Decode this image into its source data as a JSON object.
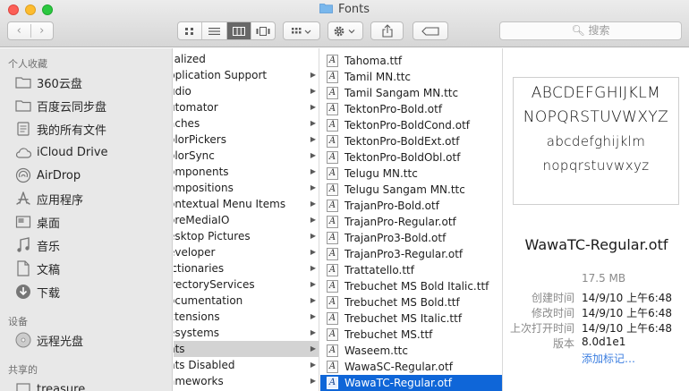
{
  "window": {
    "title": "Fonts"
  },
  "toolbar": {
    "search_placeholder": "搜索"
  },
  "sidebar": {
    "favorites_header": "个人收藏",
    "favorites": [
      {
        "label": "360云盘",
        "icon": "folder-icon"
      },
      {
        "label": "百度云同步盘",
        "icon": "folder-icon"
      },
      {
        "label": "我的所有文件",
        "icon": "all-files-icon"
      },
      {
        "label": "iCloud Drive",
        "icon": "cloud-icon"
      },
      {
        "label": "AirDrop",
        "icon": "airdrop-icon"
      },
      {
        "label": "应用程序",
        "icon": "applications-icon"
      },
      {
        "label": "桌面",
        "icon": "desktop-icon"
      },
      {
        "label": "音乐",
        "icon": "music-icon"
      },
      {
        "label": "文稿",
        "icon": "documents-icon"
      },
      {
        "label": "下载",
        "icon": "downloads-icon"
      }
    ],
    "devices_header": "设备",
    "devices": [
      {
        "label": "远程光盘",
        "icon": "disc-icon"
      }
    ],
    "shared_header": "共享的",
    "shared": [
      {
        "label": "treasure",
        "icon": "network-computer-icon"
      }
    ]
  },
  "library_column": {
    "items": [
      "calized",
      "pplication Support",
      "udio",
      "utomator",
      "aches",
      "olorPickers",
      "olorSync",
      "omponents",
      "ompositions",
      "ontextual Menu Items",
      "oreMediaIO",
      "esktop Pictures",
      "eveloper",
      "ictionaries",
      "irectoryServices",
      "ocumentation",
      "xtensions",
      "esystems",
      "nts",
      "nts Disabled",
      "ameworks"
    ],
    "selected_index": 18
  },
  "fonts_column": {
    "items": [
      "Tahoma.ttf",
      "Tamil MN.ttc",
      "Tamil Sangam MN.ttc",
      "TektonPro-Bold.otf",
      "TektonPro-BoldCond.otf",
      "TektonPro-BoldExt.otf",
      "TektonPro-BoldObl.otf",
      "Telugu MN.ttc",
      "Telugu Sangam MN.ttc",
      "TrajanPro-Bold.otf",
      "TrajanPro-Regular.otf",
      "TrajanPro3-Bold.otf",
      "TrajanPro3-Regular.otf",
      "Trattatello.ttf",
      "Trebuchet MS Bold Italic.ttf",
      "Trebuchet MS Bold.ttf",
      "Trebuchet MS Italic.ttf",
      "Trebuchet MS.ttf",
      "Waseem.ttc",
      "WawaSC-Regular.otf",
      "WawaTC-Regular.otf"
    ],
    "selected_index": 20
  },
  "preview": {
    "sample_lines": [
      "ABCDEFGHIJKLM",
      "NOPQRSTUVWXYZ",
      "abcdefghijklm",
      "nopqrstuvwxyz"
    ],
    "file_name": "WawaTC-Regular.otf",
    "size": "17.5 MB",
    "created_label": "创建时间",
    "created_value": "14/9/10 上午6:48",
    "modified_label": "修改时间",
    "modified_value": "14/9/10 上午6:48",
    "opened_label": "上次打开时间",
    "opened_value": "14/9/10 上午6:48",
    "version_label": "版本",
    "version_value": "8.0d1e1",
    "add_tags": "添加标记…"
  },
  "colors": {
    "selection_blue": "#0f66d8",
    "selection_gray": "#d3d3d3",
    "sidebar_bg": "#e8e8e8",
    "link_blue": "#3b7ee0"
  }
}
